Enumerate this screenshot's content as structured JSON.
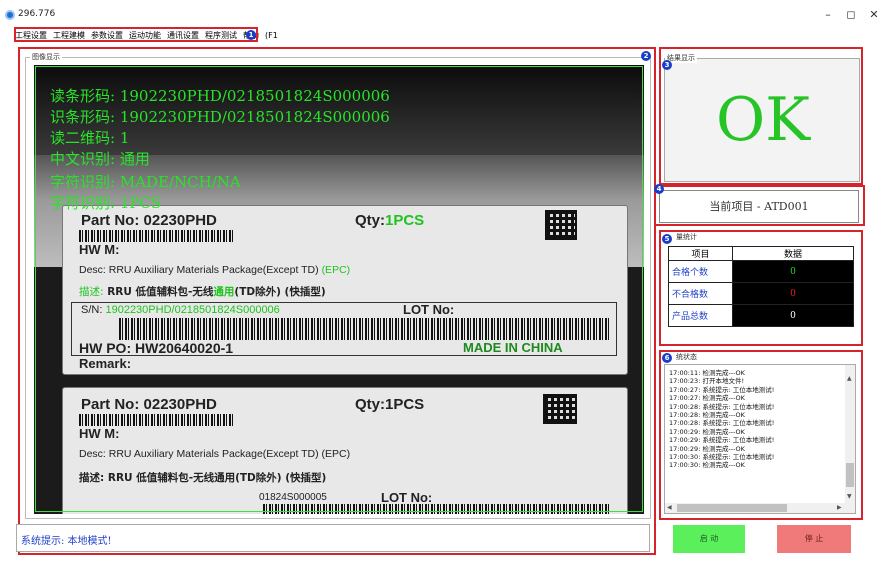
{
  "window": {
    "title": "296.776",
    "minimize": "–",
    "restore": "◻",
    "close": "✕"
  },
  "menu": [
    "工程设置",
    "工程建模",
    "参数设置",
    "运动功能",
    "通讯设置",
    "程序测试",
    "帮助",
    "(F1"
  ],
  "badges": [
    "1",
    "2",
    "3",
    "4",
    "5",
    "6"
  ],
  "image_panel": {
    "label": "图像显示",
    "overlay": [
      "读条形码: 1902230PHD/0218501824S000006",
      "识条形码: 1902230PHD/0218501824S000006",
      "读二维码: 1",
      "中文识别: 通用",
      "字符识别: MADE/NCH/NA",
      "字符识别: 1PCS"
    ],
    "label1": {
      "part": "Part No: 02230PHD",
      "qty_prefix": "Qty:",
      "qty": "1PCS",
      "hw": "HW M:",
      "desc": "Desc: RRU Auxiliary Materials Package(Except TD)",
      "desc_tag": "(EPC)",
      "cn_prefix": "描述:",
      "cn_a": "RRU 低值辅料包-无线",
      "cn_b": "通用",
      "cn_c": "(TD除外) (快插型)",
      "sn_prefix": "S/N:",
      "sn": "1902230PHD/0218501824S000006",
      "lot": "LOT No:",
      "po": "HW PO: HW20640020-1",
      "made": "MADE IN CHINA",
      "remark": "Remark:"
    },
    "label2": {
      "part": "Part No: 02230PHD",
      "qty": "Qty:1PCS",
      "hw": "HW M:",
      "desc": "Desc: RRU Auxiliary Materials Package(Except TD) (EPC)",
      "cn": "描述: RRU 低值辅料包-无线通用(TD除外) (快插型)",
      "sn_fragment": "01824S000005",
      "lot": "LOT No:"
    }
  },
  "status_bar": {
    "text": "系统提示: 本地模式!"
  },
  "result": {
    "label": "结果显示",
    "value": "OK"
  },
  "project": {
    "text": "当前项目 - ATD001"
  },
  "stats": {
    "label": "量统计",
    "headers": [
      "项目",
      "数据"
    ],
    "rows": [
      {
        "label": "合格个数",
        "value": "0",
        "color": "#27d627"
      },
      {
        "label": "不合格数",
        "value": "0",
        "color": "#e82020"
      },
      {
        "label": "产品总数",
        "value": "0",
        "color": "#ffffff"
      }
    ]
  },
  "log": {
    "label": "统状态",
    "lines": [
      "17:00:11: 检测完成---OK",
      "17:00:23: 打开本地文件!",
      "17:00:27: 系统提示: 工位本地测试!",
      "17:00:27: 检测完成---OK",
      "17:00:28: 系统提示: 工位本地测试!",
      "17:00:28: 检测完成---OK",
      "17:00:28: 系统提示: 工位本地测试!",
      "17:00:29: 检测完成---OK",
      "17:00:29: 系统提示: 工位本地测试!",
      "17:00:29: 检测完成---OK",
      "17:00:30: 系统提示: 工位本地测试!",
      "17:00:30: 检测完成---OK"
    ]
  },
  "buttons": {
    "start": "启 动",
    "stop": "停 止"
  },
  "colors": {
    "frame": "#d5242b",
    "badge": "#1a3dc8",
    "ok": "#26c426",
    "overlay": "#28e428",
    "start": "#5bf05b",
    "stop": "#f07a7a"
  }
}
